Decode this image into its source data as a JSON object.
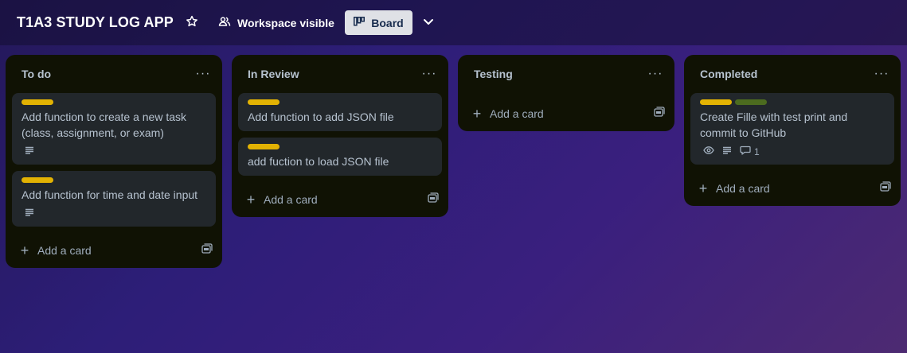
{
  "header": {
    "title": "T1A3 STUDY LOG APP",
    "star_icon": "star-icon",
    "visibility_icon": "people-icon",
    "visibility_label": "Workspace visible",
    "view_icon": "board-icon",
    "view_label": "Board",
    "chevron_icon": "chevron-down-icon"
  },
  "colors": {
    "label_yellow": "#e2b203",
    "label_green": "#4c6b1f",
    "list_bg": "#101204",
    "card_bg": "#22272b",
    "text": "#b6c2cf"
  },
  "lists": [
    {
      "title": "To do",
      "menu_label": "···",
      "add_label": "Add a card",
      "cards": [
        {
          "text": "Add function to create a new task (class, assignment, or exam)",
          "labels": [
            "yellow"
          ],
          "badges": [
            "description"
          ]
        },
        {
          "text": "Add function for time and date input",
          "labels": [
            "yellow"
          ],
          "badges": [
            "description"
          ]
        }
      ]
    },
    {
      "title": "In Review",
      "menu_label": "···",
      "add_label": "Add a card",
      "cards": [
        {
          "text": "Add function to add JSON file",
          "labels": [
            "yellow"
          ],
          "badges": []
        },
        {
          "text": "add fuction to load JSON file",
          "labels": [
            "yellow"
          ],
          "badges": []
        }
      ]
    },
    {
      "title": "Testing",
      "menu_label": "···",
      "add_label": "Add a card",
      "cards": []
    },
    {
      "title": "Completed",
      "menu_label": "···",
      "add_label": "Add a card",
      "cards": [
        {
          "text": "Create Fille with test print and commit to GitHub",
          "labels": [
            "yellow",
            "green"
          ],
          "badges": [
            "watch",
            "description",
            "comments"
          ],
          "comment_count": "1"
        }
      ]
    }
  ]
}
